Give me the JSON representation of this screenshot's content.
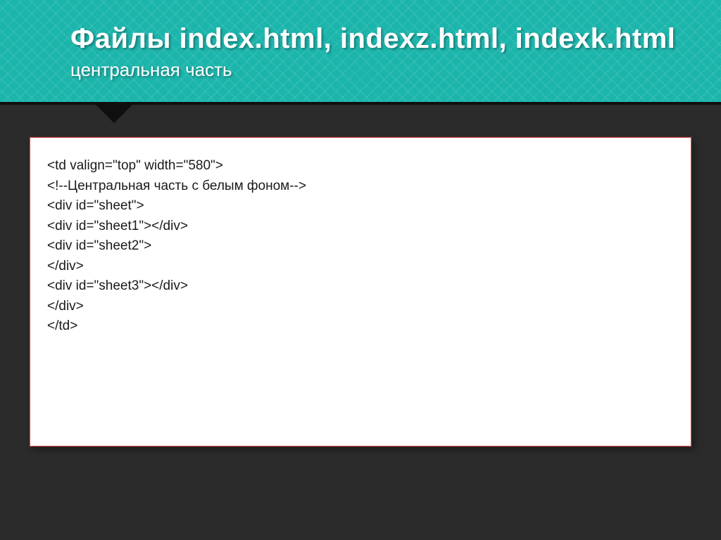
{
  "header": {
    "title": "Файлы index.html, indexz.html, indexk.html",
    "subtitle": "центральная часть"
  },
  "code": {
    "lines": [
      "<td valign=\"top\" width=\"580\">",
      "",
      "<!--Центральная часть с белым фоном-->",
      "<div id=\"sheet\">",
      "<div id=\"sheet1\"></div>",
      "<div id=\"sheet2\">",
      "",
      "",
      "</div>",
      "<div id=\"sheet3\"></div>",
      "</div>",
      "",
      "</td>"
    ]
  }
}
